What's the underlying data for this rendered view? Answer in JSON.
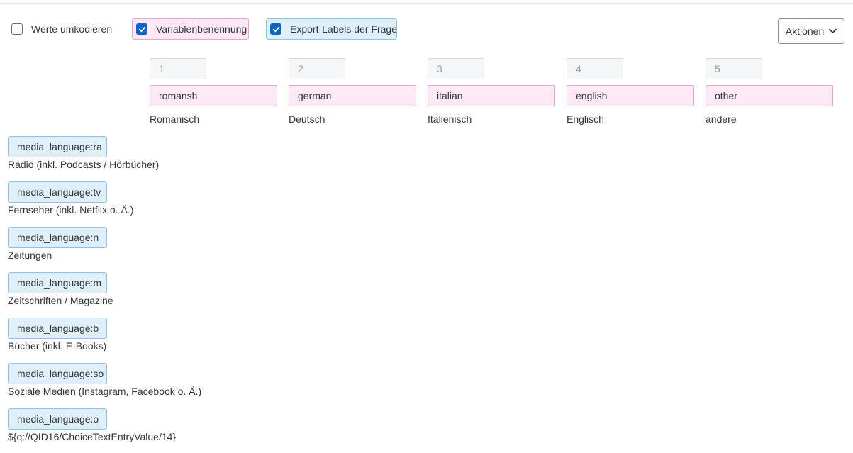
{
  "options": {
    "recode": {
      "label": "Werte umkodieren",
      "checked": false
    },
    "var_naming": {
      "label": "Variablenbenennung",
      "checked": true
    },
    "export_labels": {
      "label": "Export-Labels der Frage",
      "checked": true
    }
  },
  "actions": {
    "label": "Aktionen",
    "icon": "chevron-down-icon"
  },
  "columns": [
    {
      "number": "1",
      "code": "romansh",
      "label": "Romanisch"
    },
    {
      "number": "2",
      "code": "german",
      "label": "Deutsch"
    },
    {
      "number": "3",
      "code": "italian",
      "label": "Italienisch"
    },
    {
      "number": "4",
      "code": "english",
      "label": "Englisch"
    },
    {
      "number": "5",
      "code": "other",
      "label": "andere"
    }
  ],
  "rows": [
    {
      "variable": "media_language:ra",
      "label": "Radio (inkl. Podcasts / Hörbücher)"
    },
    {
      "variable": "media_language:tv",
      "label": "Fernseher (inkl. Netflix o. Ä.)"
    },
    {
      "variable": "media_language:n",
      "label": "Zeitungen"
    },
    {
      "variable": "media_language:m",
      "label": "Zeitschriften / Magazine"
    },
    {
      "variable": "media_language:b",
      "label": "Bücher (inkl. E-Books)"
    },
    {
      "variable": "media_language:so",
      "label": "Soziale Medien (Instagram, Facebook o. Ä.)"
    },
    {
      "variable": "media_language:o",
      "label": "${q://QID16/ChoiceTextEntryValue/14}"
    }
  ]
}
